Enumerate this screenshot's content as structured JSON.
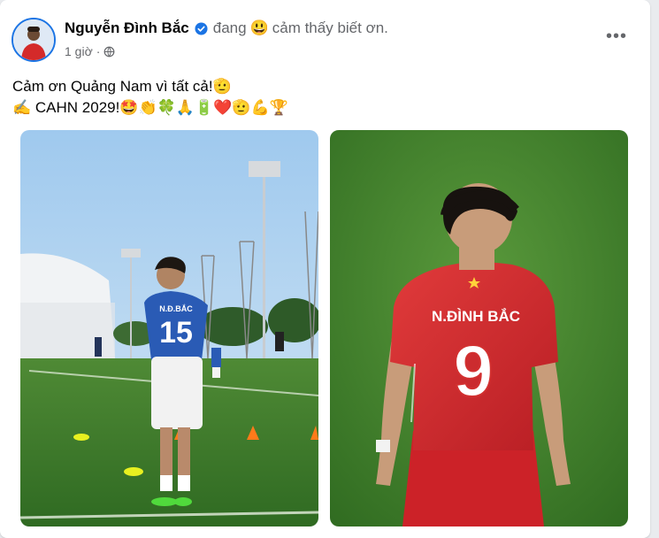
{
  "post": {
    "author_name": "Nguyễn Đình Bắc",
    "feeling_prefix": "đang",
    "feeling_emoji": "😃",
    "feeling_text": "cảm thấy biết ơn.",
    "time": "1 giờ",
    "separator": "·",
    "line1_text": "Cảm ơn Quảng Nam vì tất cả!",
    "line1_emoji": "🫡",
    "line2_prefix_emoji": "✍️",
    "line2_text": "CAHN 2029!",
    "line2_emojis": "🤩👏🍀🙏🔋❤️🫡💪🏆"
  },
  "icons": {
    "verified": "verified-badge-icon",
    "privacy": "globe-icon",
    "more": "more-options-icon"
  },
  "more_label": "•••",
  "photos": {
    "left": {
      "jersey_name": "N.Đ.BẮC",
      "jersey_number": "15"
    },
    "right": {
      "jersey_name": "N.ĐÌNH BẮC",
      "jersey_number": "9"
    }
  },
  "colors": {
    "verified_blue": "#1b74e4",
    "text_primary": "#050505",
    "text_secondary": "#65676b"
  }
}
